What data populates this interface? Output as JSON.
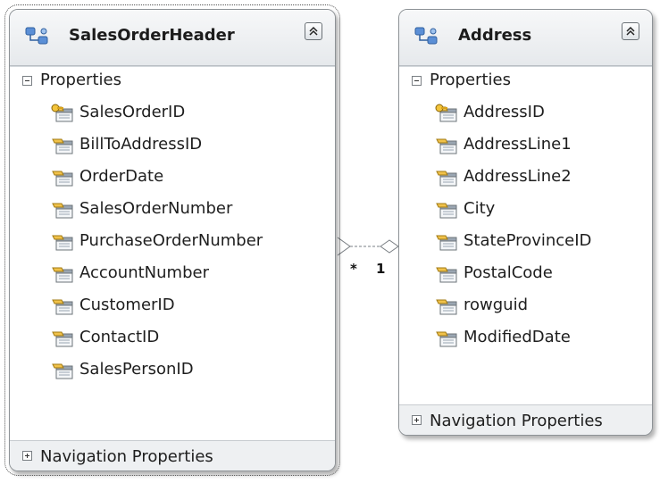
{
  "entities": {
    "sales_order_header": {
      "title": "SalesOrderHeader",
      "properties_label": "Properties",
      "navigation_label": "Navigation Properties",
      "properties": [
        "SalesOrderID",
        "BillToAddressID",
        "OrderDate",
        "SalesOrderNumber",
        "PurchaseOrderNumber",
        "AccountNumber",
        "CustomerID",
        "ContactID",
        "SalesPersonID"
      ]
    },
    "address": {
      "title": "Address",
      "properties_label": "Properties",
      "navigation_label": "Navigation Properties",
      "properties": [
        "AddressID",
        "AddressLine1",
        "AddressLine2",
        "City",
        "StateProvinceID",
        "PostalCode",
        "rowguid",
        "ModifiedDate"
      ]
    }
  },
  "association": {
    "many_label": "*",
    "one_label": "1"
  },
  "icons": {
    "entity": "entity-type-icon",
    "key_property": "key-property-icon",
    "scalar_property": "scalar-property-icon",
    "collapse": "collapse-chevron-icon"
  }
}
